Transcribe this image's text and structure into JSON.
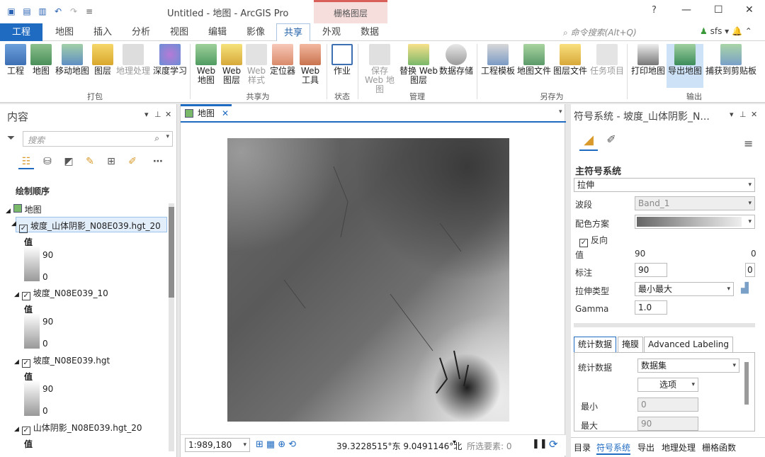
{
  "titlebar": {
    "title": "Untitled - 地图 - ArcGIS Pro",
    "context_tab": "栅格图层",
    "help": "?",
    "min": "—",
    "max": "☐",
    "close": "✕"
  },
  "ribbon_tabs": [
    "工程",
    "地图",
    "插入",
    "分析",
    "视图",
    "编辑",
    "影像",
    "共享",
    "外观",
    "数据"
  ],
  "command_search": "命令搜索(Alt+Q)",
  "user": "sfs",
  "ribbon_groups": [
    {
      "label": "打包",
      "buttons": [
        "工程",
        "地图",
        "移动地图",
        "图层",
        "地理处理",
        "深度学习"
      ]
    },
    {
      "label": "共享为",
      "buttons": [
        "Web 地图",
        "Web 图层",
        "Web 样式",
        "定位器",
        "Web 工具"
      ]
    },
    {
      "label": "状态",
      "buttons": [
        "作业"
      ]
    },
    {
      "label": "管理",
      "buttons": [
        "保存 Web 地图",
        "替换 Web 图层",
        "数据存储"
      ]
    },
    {
      "label": "另存为",
      "buttons": [
        "工程模板",
        "地图文件",
        "图层文件",
        "任务项目"
      ]
    },
    {
      "label": "输出",
      "buttons": [
        "打印地图",
        "导出地图",
        "捕获到剪贴板"
      ]
    }
  ],
  "contents": {
    "title": "内容",
    "search_placeholder": "搜索",
    "draw_order": "绘制顺序",
    "map": "地图",
    "layers": [
      {
        "name": "坡度_山体阴影_N08E039.hgt_20",
        "value_label": "值",
        "max": "90",
        "min": "0"
      },
      {
        "name": "坡度_N08E039_10",
        "value_label": "值",
        "max": "90",
        "min": "0"
      },
      {
        "name": "坡度_N08E039.hgt",
        "value_label": "值",
        "max": "90",
        "min": "0"
      },
      {
        "name": "山体阴影_N08E039.hgt_20",
        "value_label": "值"
      }
    ]
  },
  "map": {
    "tab": "地图",
    "scale": "1:989,180",
    "coords": "39.3228515°东 9.0491146°北",
    "selected": "所选要素: 0"
  },
  "symbology": {
    "title": "符号系统 - 坡度_山体阴影_N...",
    "primary": "主符号系统",
    "type": "拉伸",
    "band_label": "波段",
    "band": "Band_1",
    "ramp_label": "配色方案",
    "invert": "反向",
    "value_label": "值",
    "value_high": "90",
    "value_low": "0",
    "label_label": "标注",
    "label_high": "90",
    "label_low": "0",
    "stretch_label": "拉伸类型",
    "stretch": "最小最大",
    "gamma_label": "Gamma",
    "gamma": "1.0",
    "tabs": [
      "统计数据",
      "掩膜",
      "Advanced Labeling"
    ],
    "stats_label": "统计数据",
    "stats": "数据集",
    "options": "选项",
    "min_label": "最小",
    "min": "0",
    "max_label": "最大",
    "max": "90"
  },
  "bottom_tabs": [
    "目录",
    "符号系统",
    "导出",
    "地理处理",
    "栅格函数"
  ]
}
